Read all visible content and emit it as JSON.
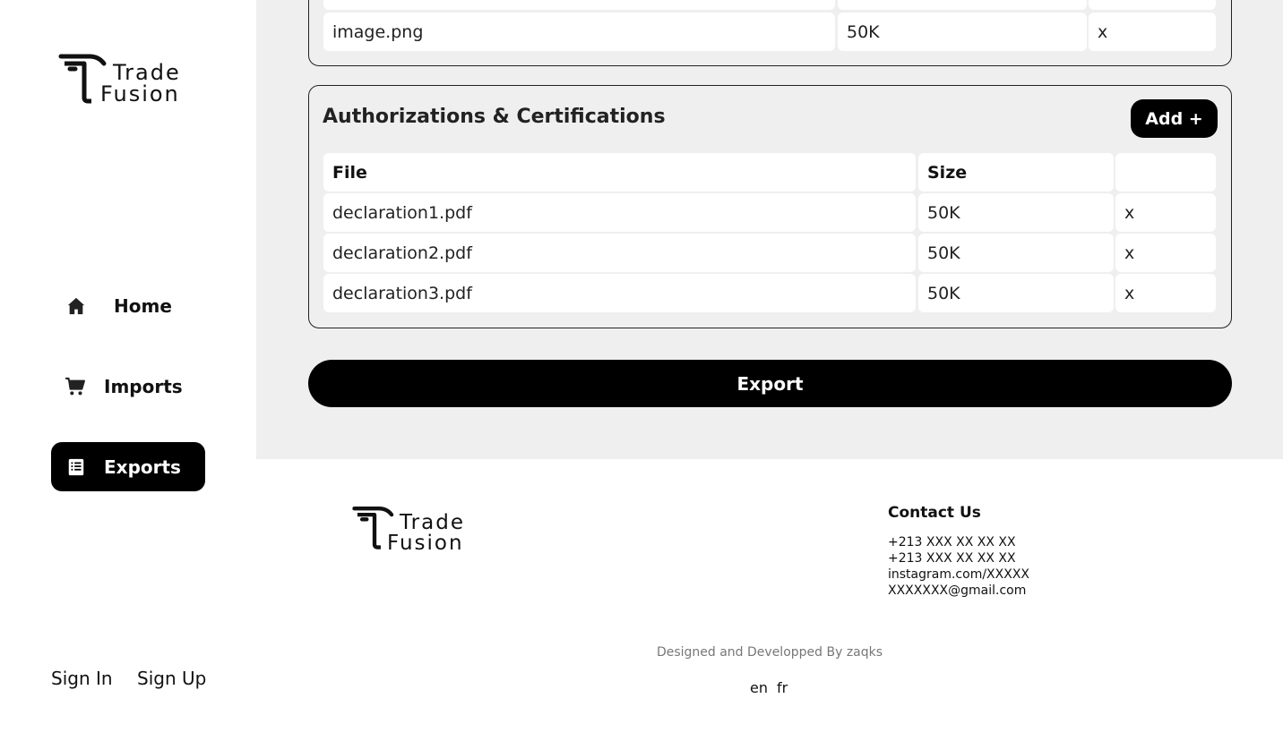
{
  "brand": {
    "line1": "Trade",
    "line2": "Fusion"
  },
  "nav": {
    "items": [
      {
        "label": "Home",
        "icon": "home-icon",
        "active": false
      },
      {
        "label": "Imports",
        "icon": "cart-icon",
        "active": false
      },
      {
        "label": "Exports",
        "icon": "document-list-icon",
        "active": true
      }
    ]
  },
  "auth": {
    "sign_in": "Sign In",
    "sign_up": "Sign Up"
  },
  "previous_table": {
    "rows": [
      {
        "file": "image.png",
        "size": "50K",
        "remove": "x"
      }
    ]
  },
  "authorizations": {
    "title": "Authorizations & Certifications",
    "add_label": "Add +",
    "columns": {
      "file": "File",
      "size": "Size",
      "action": ""
    },
    "rows": [
      {
        "file": "declaration1.pdf",
        "size": "50K",
        "remove": "x"
      },
      {
        "file": "declaration2.pdf",
        "size": "50K",
        "remove": "x"
      },
      {
        "file": "declaration3.pdf",
        "size": "50K",
        "remove": "x"
      }
    ]
  },
  "export_label": "Export",
  "footer": {
    "contact_title": "Contact Us",
    "contact_lines": [
      "+213 XXX XX XX XX",
      "+213 XXX XX XX XX",
      "instagram.com/XXXXX",
      "XXXXXXX@gmail.com"
    ],
    "credit": "Designed and Developped By zaqks",
    "languages": [
      "en",
      "fr"
    ]
  },
  "colors": {
    "accent": "#000000",
    "main_bg": "#efefef",
    "cell_bg": "#ffffff",
    "muted_text": "#777777"
  }
}
